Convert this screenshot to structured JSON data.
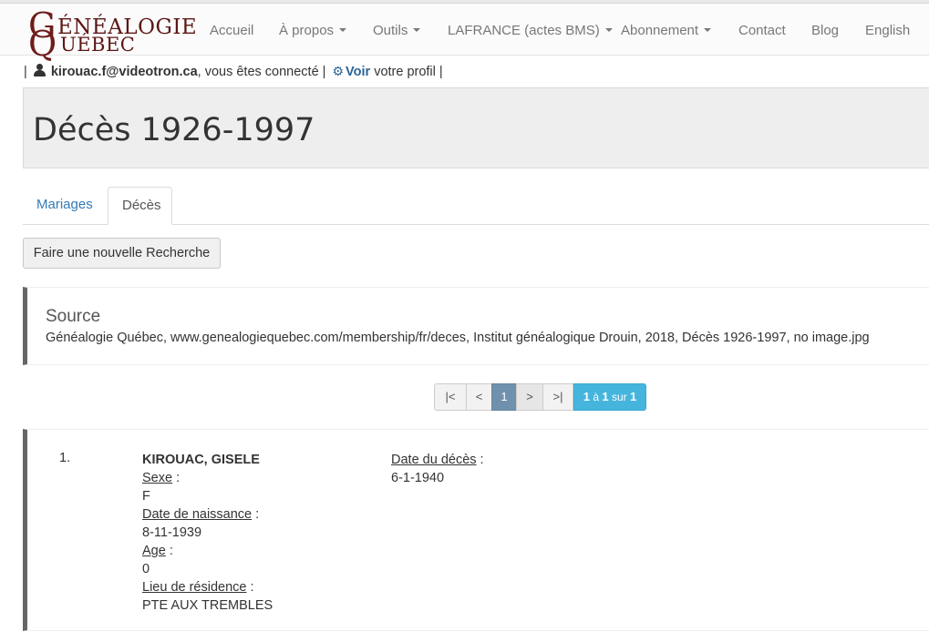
{
  "logo": {
    "line1_initial": "G",
    "line1_rest": "ÉNÉALOGIE",
    "line2_initial": "Q",
    "line2_rest": "UÉBEC",
    "color": "#6e1d1b"
  },
  "nav": {
    "items": [
      {
        "label": "Accueil",
        "dropdown": false
      },
      {
        "label": "À propos",
        "dropdown": true
      },
      {
        "label": "Outils",
        "dropdown": true
      },
      {
        "label": "LAFRANCE (actes BMS)",
        "dropdown": true
      },
      {
        "label": "Abonnement",
        "dropdown": true
      },
      {
        "label": "Contact",
        "dropdown": false
      },
      {
        "label": "Blog",
        "dropdown": false
      },
      {
        "label": "English",
        "dropdown": false
      }
    ]
  },
  "userbar": {
    "sep_open": "|",
    "email": "kirouac.f@videotron.ca",
    "connected_text": ", vous êtes connecté |",
    "view_link": "Voir",
    "profile_text": "votre profil |",
    "icons": [
      "user-icon",
      "gear-icon"
    ]
  },
  "page": {
    "title": "Décès 1926-1997"
  },
  "tabs": [
    {
      "label": "Mariages",
      "active": false
    },
    {
      "label": "Décès",
      "active": true
    }
  ],
  "actions": {
    "new_search": "Faire une nouvelle Recherche"
  },
  "source": {
    "heading": "Source",
    "text": "Généalogie Québec, www.genealogiequebec.com/membership/fr/deces, Institut généalogique Drouin, 2018, Décès 1926-1997, no image.jpg"
  },
  "pagination": {
    "first": "|<",
    "prev": "<",
    "current": "1",
    "next": ">",
    "last": ">|",
    "info_from": "1",
    "info_mid": " à ",
    "info_to": "1",
    "info_sur": " sur ",
    "info_total": "1",
    "accent": "#46b5de"
  },
  "record": {
    "number": "1.",
    "name": "KIROUAC, GISELE",
    "sex_label": "Sexe",
    "sex_value": "F",
    "birth_label": "Date de naissance",
    "birth_value": "8-11-1939",
    "age_label": "Age",
    "age_value": "0",
    "residence_label": "Lieu de résidence",
    "residence_value": "PTE AUX TREMBLES",
    "death_label": "Date du décès",
    "death_value": "6-1-1940",
    "colon": " :"
  }
}
